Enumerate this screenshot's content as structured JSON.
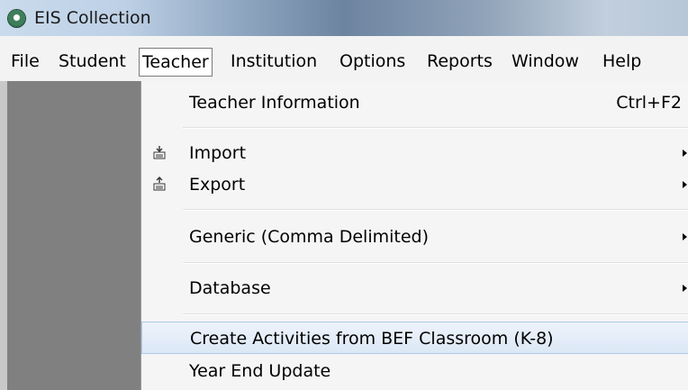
{
  "window": {
    "title": "EIS Collection"
  },
  "menubar": {
    "items": [
      "File",
      "Student",
      "Teacher",
      "Institution",
      "Options",
      "Reports",
      "Window",
      "Help"
    ],
    "active": "Teacher"
  },
  "teacher_menu": {
    "teacher_information": {
      "label": "Teacher Information",
      "shortcut": "Ctrl+F2"
    },
    "import": {
      "label": "Import",
      "icon": "import-icon"
    },
    "export": {
      "label": "Export",
      "icon": "export-icon"
    },
    "generic": {
      "label": "Generic (Comma Delimited)"
    },
    "database": {
      "label": "Database"
    },
    "create_activities": {
      "label": "Create Activities from BEF Classroom (K-8)"
    },
    "year_end_update": {
      "label": "Year End Update"
    }
  },
  "colors": {
    "workspace": "#808080",
    "menu_background": "#f5f5f5",
    "highlight": "#dce8f6"
  }
}
